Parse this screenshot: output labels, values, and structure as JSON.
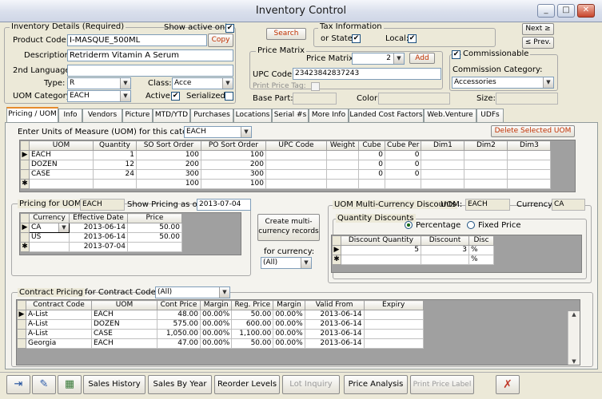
{
  "window": {
    "title": "Inventory Control",
    "min": "_",
    "max": "□",
    "close": "✕"
  },
  "details": {
    "legend": "Inventory Details (Required)",
    "show_active_label": "Show active only:",
    "show_active": "✔",
    "product_code_label": "Product Code:",
    "product_code": "I-MASQUE_500ML",
    "copy": "Copy",
    "description_label": "Description:",
    "description": "Retriderm Vitamin A Serum",
    "second_lang_label": "2nd Language:",
    "second_lang": "",
    "type_label": "Type:",
    "type": "R",
    "class_label": "Class:",
    "class": "Acce",
    "uom_cat_label": "UOM Category:",
    "uom_cat": "EACH",
    "active_label": "Active:",
    "active": "✔",
    "serialized_label": "Serialized:",
    "serialized": ""
  },
  "search": "Search",
  "tax": {
    "legend": "Tax Information",
    "state_label": "or State:",
    "state": "✔",
    "local_label": "Local:",
    "local": "✔"
  },
  "nav": {
    "next": "Next ≥",
    "prev": "≤ Prev."
  },
  "price_matrix": {
    "legend": "Price Matrix",
    "label": "Price Matrix:",
    "value": "2",
    "add": "Add",
    "upc_label": "UPC Code:",
    "upc": "234238428372​43",
    "print_tag": "Print Price Tag:",
    "base_part": "Base Part:",
    "color": "Color:",
    "size": "Size:"
  },
  "commission": {
    "label": "Commissionable",
    "check": "✔",
    "category_label": "Commission Category:",
    "category": "Accessories"
  },
  "tabs": [
    "Pricing / UOM",
    "Info",
    "Vendors",
    "Picture",
    "MTD/YTD",
    "Purchases",
    "Locations",
    "Serial #s",
    "More Info",
    "Landed Cost Factors",
    "Web.Venture",
    "UDFs"
  ],
  "uom": {
    "label": "Enter Units of Measure (UOM) for this category:",
    "category": "EACH",
    "delete": "Delete Selected UOM",
    "headers": [
      "UOM",
      "Quantity",
      "SO Sort Order",
      "PO Sort Order",
      "UPC Code",
      "Weight",
      "Cube",
      "Cube Per",
      "Dim1",
      "Dim2",
      "Dim3"
    ],
    "rows": [
      [
        "EACH",
        "1",
        "100",
        "100",
        "",
        "",
        "0",
        "0",
        "",
        "",
        ""
      ],
      [
        "DOZEN",
        "12",
        "200",
        "200",
        "",
        "",
        "0",
        "0",
        "",
        "",
        ""
      ],
      [
        "CASE",
        "24",
        "300",
        "300",
        "",
        "",
        "0",
        "0",
        "",
        "",
        ""
      ],
      [
        "",
        "",
        "100",
        "100",
        "",
        "",
        "",
        "",
        "",
        "",
        ""
      ]
    ]
  },
  "pricing": {
    "legend": "Pricing for UOM:",
    "uom": "EACH",
    "show_label": "Show Pricing as of:",
    "date": "2013-07-04",
    "headers": [
      "Currency",
      "Effective Date",
      "Price"
    ],
    "rows": [
      [
        "CA",
        "2013-06-14",
        "50.00"
      ],
      [
        "US",
        "2013-06-14",
        "50.00"
      ],
      [
        "",
        "2013-07-04",
        ""
      ]
    ]
  },
  "multi": {
    "create": "Create multi-currency records",
    "for_currency": "for currency:",
    "currency": "(All)"
  },
  "discounts": {
    "legend": "UOM Multi-Currency Discounts",
    "uom_label": "UOM:",
    "uom": "EACH",
    "currency_label": "Currency:",
    "currency": "CA",
    "qty_legend": "Quantity Discounts",
    "percentage": "Percentage",
    "fixed": "Fixed Price",
    "headers": [
      "Discount Quantity",
      "Discount",
      "Disc"
    ],
    "rows": [
      [
        "5",
        "3",
        "%"
      ],
      [
        "",
        "",
        "%"
      ]
    ]
  },
  "contract": {
    "legend": "Contract Pricing",
    "code_label": "for Contract Code:",
    "code": "(All)",
    "headers": [
      "Contract Code",
      "UOM",
      "Cont Price",
      "Margin",
      "Reg. Price",
      "Margin",
      "Valid From",
      "Expiry"
    ],
    "rows": [
      [
        "A-List",
        "EACH",
        "48.00",
        "00.00%",
        "50.00",
        "00.00%",
        "2013-06-14",
        ""
      ],
      [
        "A-List",
        "DOZEN",
        "575.00",
        "00.00%",
        "600.00",
        "00.00%",
        "2013-06-14",
        ""
      ],
      [
        "A-List",
        "CASE",
        "1,050.00",
        "00.00%",
        "1,100.00",
        "00.00%",
        "2013-06-14",
        ""
      ],
      [
        "Georgia",
        "EACH",
        "47.00",
        "00.00%",
        "50.00",
        "00.00%",
        "2013-06-14",
        ""
      ]
    ]
  },
  "bottom": {
    "sales_history": "Sales History",
    "sales_by_year": "Sales By Year",
    "reorder": "Reorder Levels",
    "lot": "Lot Inquiry",
    "price_analysis": "Price Analysis",
    "print_label": "Print Price Label"
  }
}
